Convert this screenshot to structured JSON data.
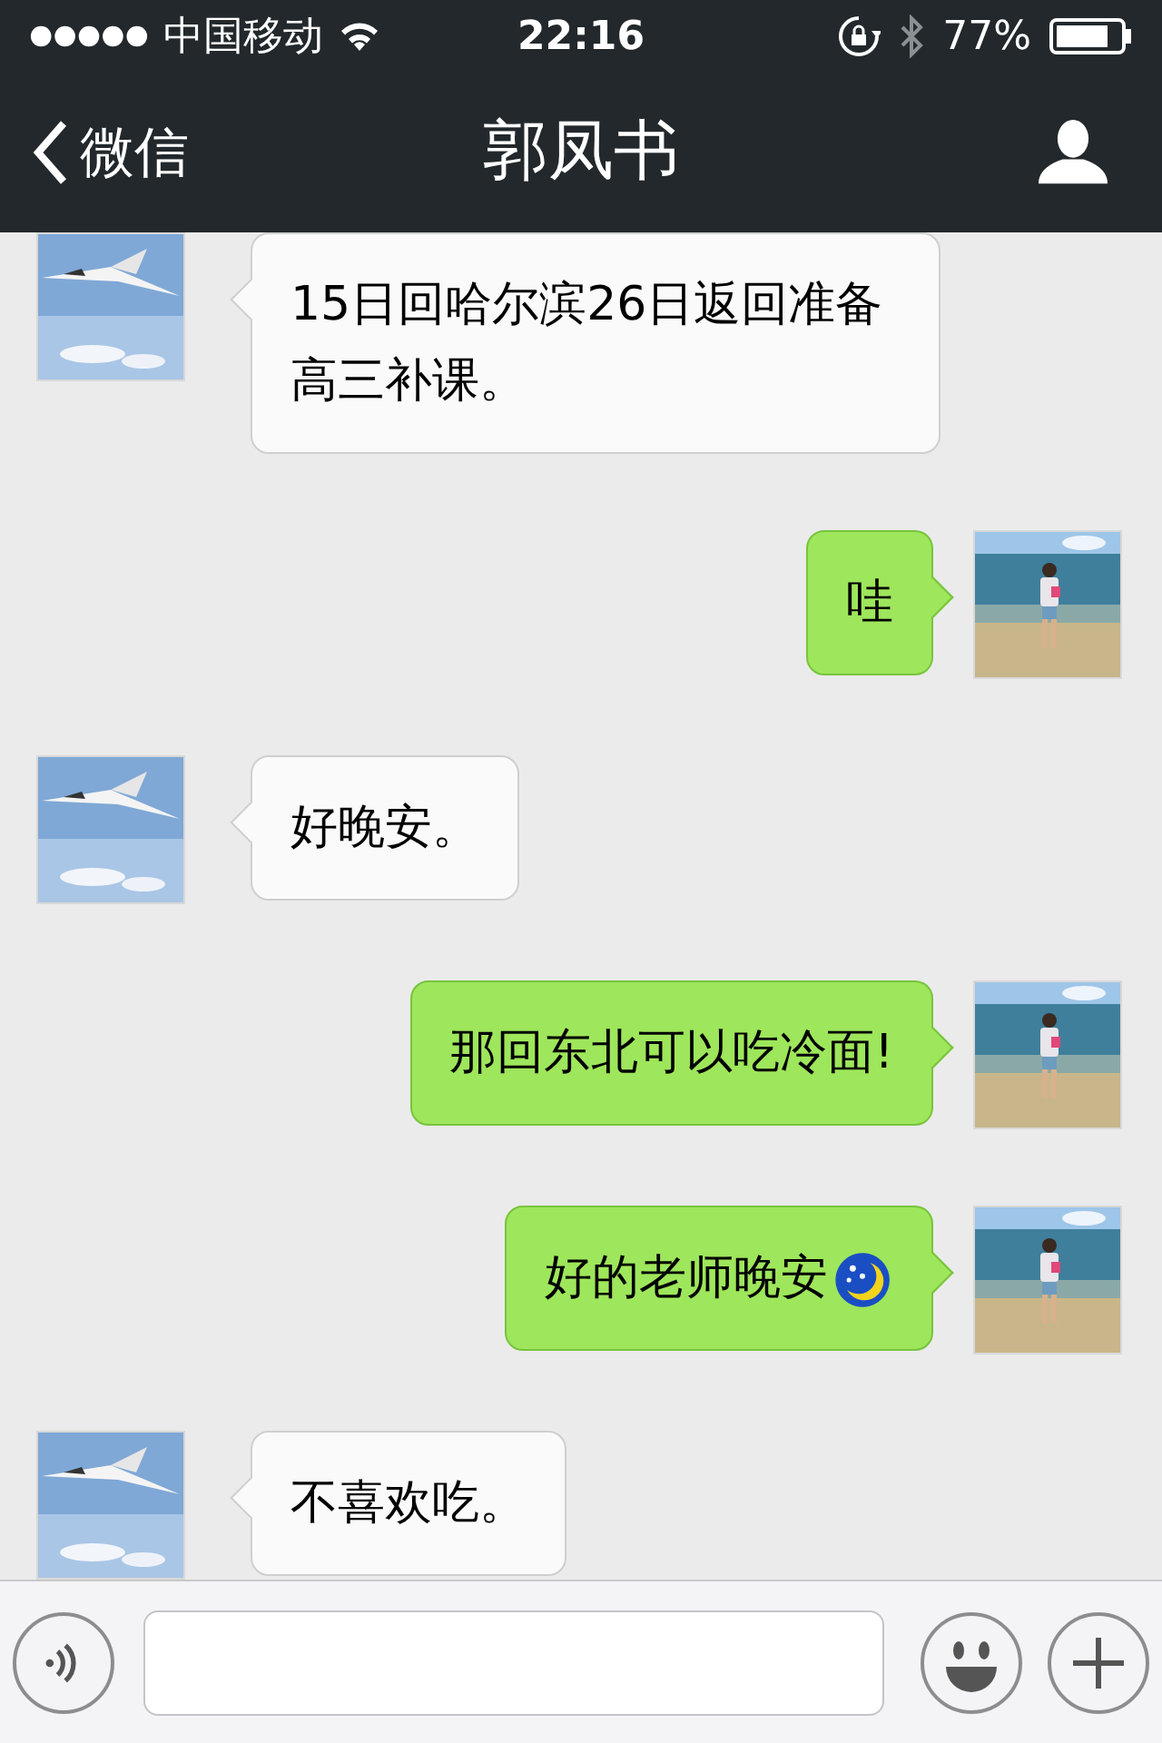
{
  "status_bar": {
    "carrier": "中国移动",
    "time": "22:16",
    "battery": "77%"
  },
  "nav_bar": {
    "back_label": "微信",
    "title": "郭凤书"
  },
  "messages": [
    {
      "kind": "incoming",
      "text": "15日回哈尔滨26日返回准备高三补课。"
    },
    {
      "kind": "outgoing",
      "text": "哇"
    },
    {
      "kind": "incoming",
      "text": "好晚安。"
    },
    {
      "kind": "outgoing",
      "text": "那回东北可以吃冷面!"
    },
    {
      "kind": "outgoing",
      "text": "好的老师晚安",
      "has_emoji": true
    },
    {
      "kind": "incoming",
      "text": "不喜欢吃。"
    }
  ]
}
